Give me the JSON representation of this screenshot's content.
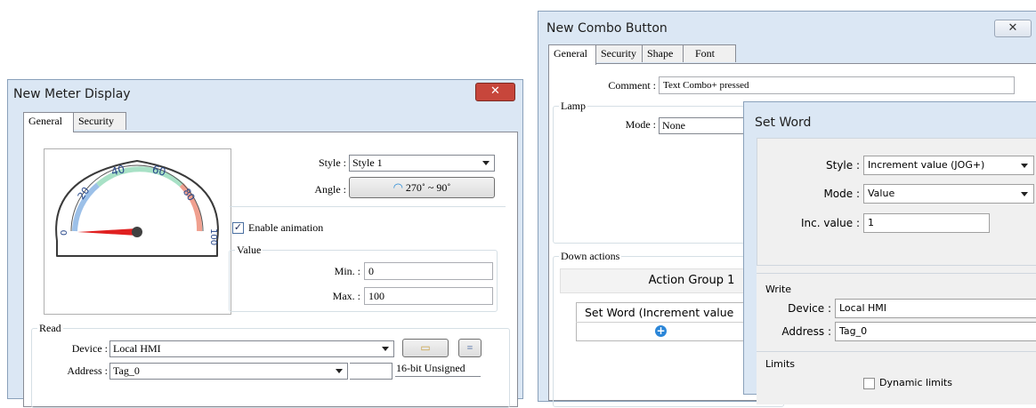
{
  "meter_dialog": {
    "title": "New Meter Display",
    "close_label": "✕",
    "tabs": [
      "General",
      "Security"
    ],
    "gauge": {
      "ticks": [
        "0",
        "20",
        "40",
        "60",
        "80",
        "100"
      ]
    },
    "style_label": "Style :",
    "style_value": "Style 1",
    "angle_label": "Angle :",
    "angle_value": "270˚ ~ 90˚",
    "enable_animation_label": "Enable animation",
    "enable_animation_checked": true,
    "value_group_label": "Value",
    "min_label": "Min. :",
    "min_value": "0",
    "max_label": "Max. :",
    "max_value": "100",
    "read_group_label": "Read",
    "device_label": "Device :",
    "device_value": "Local HMI",
    "address_label": "Address :",
    "address_value": "Tag_0",
    "data_type": "16-bit Unsigned"
  },
  "combo_dialog": {
    "title": "New Combo Button",
    "close_label": "✕",
    "tabs": [
      "General",
      "Security",
      "Shape",
      "Font"
    ],
    "comment_label": "Comment :",
    "comment_value": "Text Combo+ pressed",
    "lamp_group_label": "Lamp",
    "mode_label": "Mode :",
    "mode_value": "None",
    "down_actions_label": "Down actions",
    "action_group_title": "Action Group 1",
    "action_item": "Set Word (Increment value",
    "add_icon": "plus-circle-icon"
  },
  "setword_dialog": {
    "title": "Set Word",
    "style_label": "Style :",
    "style_value": "Increment value (JOG+)",
    "mode_label": "Mode :",
    "mode_value": "Value",
    "inc_label": "Inc. value :",
    "inc_value": "1",
    "write_group_label": "Write",
    "device_label": "Device :",
    "device_value": "Local HMI",
    "address_label": "Address :",
    "address_value": "Tag_0",
    "limits_group_label": "Limits",
    "dynamic_limits_label": "Dynamic limits"
  }
}
